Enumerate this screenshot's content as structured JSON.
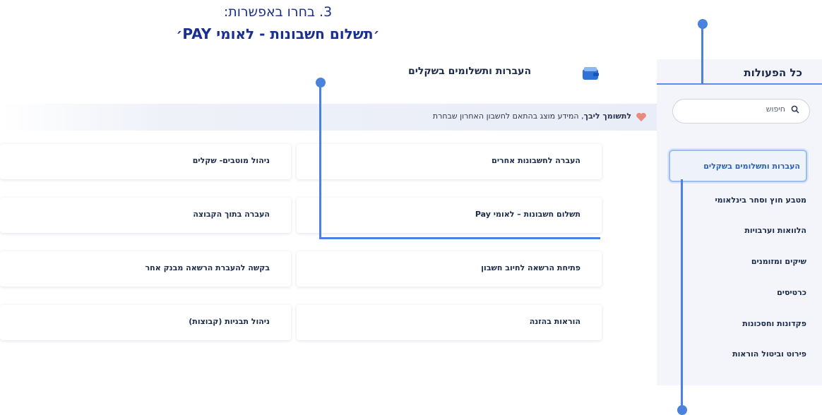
{
  "instructions": {
    "step": "3. בחרו באפשרות:",
    "option": "׳תשלום חשבונות - לאומי PAY׳"
  },
  "sidebar": {
    "title": "כל הפעולות",
    "search_placeholder": "חיפוש",
    "items": [
      {
        "label": "העברות ותשלומים בשקלים",
        "active": true
      },
      {
        "label": "מטבע חוץ וסחר בינלאומי"
      },
      {
        "label": "הלוואות וערבויות"
      },
      {
        "label": "שיקים ומזומנים"
      },
      {
        "label": "כרטיסים"
      },
      {
        "label": "פקדונות וחסכונות"
      },
      {
        "label": "פירוט וביטול הוראות"
      }
    ]
  },
  "main": {
    "title": "העברות ותשלומים בשקלים",
    "notice_bold": "לתשומך ליבך",
    "notice_rest": ", המידע מוצג בהתאם לחשבון האחרון שבחרת",
    "cards_right": [
      "העברה לחשבונות אחרים",
      "תשלום חשבונות – לאומי Pay",
      "פתיחת הרשאה לחיוב חשבון",
      "הוראות בהזנה"
    ],
    "cards_left": [
      "ניהול מוטבים- שקלים",
      "העברה בתוך הקבוצה",
      "בקשה להעברת הרשאה מבנק אחר",
      "ניהול תבניות (קבוצות)"
    ]
  },
  "colors": {
    "annotation": "#4a82de",
    "instruction_text": "#1a2f8f",
    "sidebar_bg": "#f3f5fa",
    "heart": "#e98a7d"
  },
  "icons": [
    "wallet-icon",
    "search-icon",
    "heart-icon"
  ]
}
